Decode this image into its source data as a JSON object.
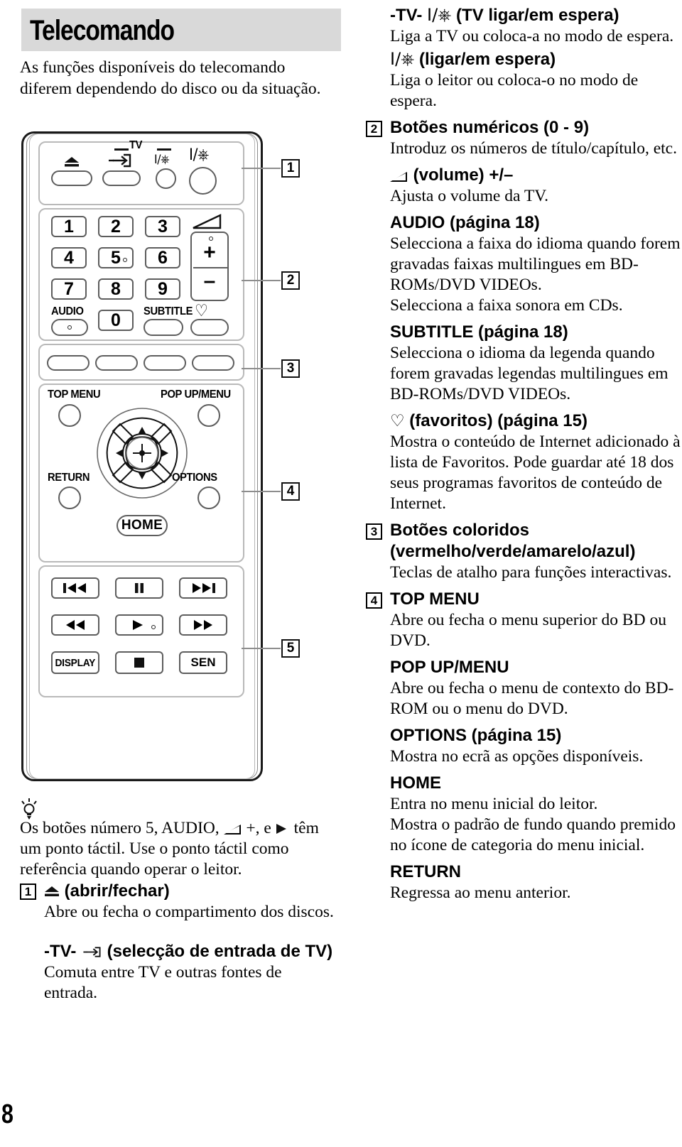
{
  "page": {
    "number": "8",
    "section_title": "Telecomando",
    "intro": "As funções disponíveis do telecomando diferem dependendo do disco ou da situação."
  },
  "remote": {
    "alt": "Diagrama do telecomando",
    "tv_label": "TV",
    "top_row": {
      "eject_icon": "eject-icon",
      "tv_input_icon": "tv-input-select-icon",
      "tv_power_icon": "tv-power-standby-icon",
      "power_icon": "power-standby-icon"
    },
    "number_buttons": [
      "1",
      "2",
      "3",
      "4",
      "5",
      "6",
      "7",
      "8",
      "9",
      "0"
    ],
    "volume": {
      "plus": "+",
      "minus": "–",
      "icon": "volume-icon"
    },
    "audio_label": "AUDIO",
    "subtitle_label": "SUBTITLE",
    "favorites_icon": "heart-favorites-icon",
    "color_buttons": [
      "vermelho",
      "verde",
      "amarelo",
      "azul"
    ],
    "top_menu_label": "TOP MENU",
    "pop_up_menu_label": "POP UP/MENU",
    "return_label": "RETURN",
    "options_label": "OPTIONS",
    "home_label": "HOME",
    "dpad": {
      "up": "up-arrow-icon",
      "down": "down-arrow-icon",
      "left": "left-arrow-icon",
      "right": "right-arrow-icon",
      "enter": "enter-center-icon"
    },
    "transport": {
      "prev": "previous-icon",
      "pause": "pause-icon",
      "next": "next-icon",
      "rewind": "rewind-icon",
      "play": "play-icon",
      "fast_forward": "fast-forward-icon",
      "display_label": "DISPLAY",
      "stop": "stop-icon",
      "sen_label": "SEN"
    },
    "callouts": [
      "1",
      "2",
      "3",
      "4",
      "5"
    ]
  },
  "tip": {
    "icon": "tip-bulb-icon",
    "text_part1": "Os botões número 5, AUDIO, ",
    "text_vol": "volume-icon",
    "text_part2": " +, e ",
    "text_play": "play-icon",
    "text_part3": " têm um ponto táctil. Use o ponto táctil como referência quando operar o leitor."
  },
  "left_entries": [
    {
      "num": "1",
      "head_icon": "eject-icon",
      "head": " (abrir/fechar)",
      "body": "Abre ou fecha o compartimento dos discos."
    },
    {
      "num": "",
      "head_prefix": "-TV- ",
      "head_icon": "tv-input-select-icon",
      "head": " (selecção de entrada de TV)",
      "body": "Comuta entre TV e outras fontes de entrada."
    }
  ],
  "right_entries": [
    {
      "num": "",
      "head_prefix": "-TV- ",
      "head_icon": "power-standby-icon",
      "head_suffix": " (TV ligar/em espera)",
      "body": [
        "Liga a TV ou coloca-a no modo de espera."
      ]
    },
    {
      "num": "",
      "head_prefix": "",
      "head_icon": "power-standby-icon",
      "head_suffix": " (ligar/em espera)",
      "body": [
        "Liga o leitor ou coloca-o no modo de espera."
      ]
    },
    {
      "num": "2",
      "head_prefix": "",
      "head_icon": "",
      "head_suffix": "Botões numéricos (0 - 9)",
      "body": [
        "Introduz os números de título/capítulo, etc."
      ]
    },
    {
      "num": "",
      "head_prefix": "",
      "head_icon": "volume-icon",
      "head_suffix": " (volume) +/–",
      "body": [
        "Ajusta o volume da TV."
      ]
    },
    {
      "num": "",
      "head_prefix": "",
      "head_icon": "",
      "head_suffix": "AUDIO (página 18)",
      "body": [
        "Selecciona a faixa do idioma quando forem gravadas faixas multilingues em BD-ROMs/DVD VIDEOs.",
        "Selecciona a faixa sonora em CDs."
      ]
    },
    {
      "num": "",
      "head_prefix": "",
      "head_icon": "",
      "head_suffix": "SUBTITLE (página 18)",
      "body": [
        "Selecciona o idioma da legenda quando forem gravadas legendas multilingues em BD-ROMs/DVD VIDEOs."
      ]
    },
    {
      "num": "",
      "head_prefix": "",
      "head_icon": "heart-favorites-icon",
      "head_suffix": " (favoritos) (página 15)",
      "body": [
        "Mostra o conteúdo de Internet adicionado à lista de Favoritos. Pode guardar até 18 dos seus programas favoritos de conteúdo de Internet."
      ]
    },
    {
      "num": "3",
      "head_prefix": "",
      "head_icon": "",
      "head_suffix": "Botões coloridos (vermelho/verde/amarelo/azul)",
      "body": [
        "Teclas de atalho para funções interactivas."
      ]
    },
    {
      "num": "4",
      "head_prefix": "",
      "head_icon": "",
      "head_suffix": "TOP MENU",
      "body": [
        "Abre ou fecha o menu superior do BD ou DVD."
      ]
    },
    {
      "num": "",
      "head_prefix": "",
      "head_icon": "",
      "head_suffix": "POP UP/MENU",
      "body": [
        "Abre ou fecha o menu de contexto do BD-ROM ou o menu do DVD."
      ]
    },
    {
      "num": "",
      "head_prefix": "",
      "head_icon": "",
      "head_suffix": "OPTIONS (página 15)",
      "body": [
        "Mostra no ecrã as opções disponíveis."
      ]
    },
    {
      "num": "",
      "head_prefix": "",
      "head_icon": "",
      "head_suffix": "HOME",
      "body": [
        "Entra no menu inicial do leitor.",
        "Mostra o padrão de fundo quando premido no ícone de categoria do menu inicial."
      ]
    },
    {
      "num": "",
      "head_prefix": "",
      "head_icon": "",
      "head_suffix": "RETURN",
      "body": [
        "Regressa ao menu anterior."
      ]
    }
  ],
  "colors": {
    "title_bar_bg": "#d9d9d9",
    "remote_outline": "#1a1a1a",
    "group_outline": "#b9b9b9",
    "button_outline": "#5d5d5d",
    "leader_line": "#8d8d8d"
  }
}
